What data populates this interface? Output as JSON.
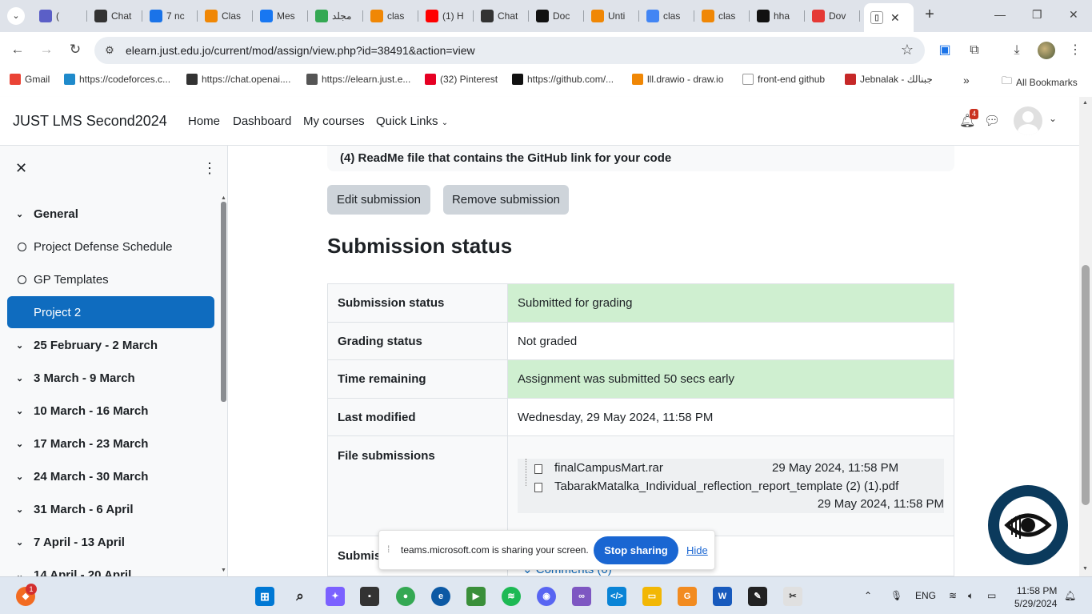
{
  "browser": {
    "tabs": [
      {
        "label": "(",
        "icon": "teams-icon",
        "color": "#5b5fc7"
      },
      {
        "label": "Chat",
        "icon": "chatgpt-icon",
        "color": "#333333"
      },
      {
        "label": "7 nc",
        "icon": "seven-icon",
        "color": "#1a73e8"
      },
      {
        "label": "Clas",
        "icon": "drawio-icon",
        "color": "#f08705"
      },
      {
        "label": "Mes",
        "icon": "facebook-icon",
        "color": "#1877f2"
      },
      {
        "label": "مجلد",
        "icon": "drive-icon",
        "color": "#34a853"
      },
      {
        "label": "clas",
        "icon": "drawio-icon",
        "color": "#f08705"
      },
      {
        "label": "(1) H",
        "icon": "youtube-icon",
        "color": "#ff0000"
      },
      {
        "label": "Chat",
        "icon": "chatgpt-icon",
        "color": "#333333"
      },
      {
        "label": "Doc",
        "icon": "notion-icon",
        "color": "#111111"
      },
      {
        "label": "Unti",
        "icon": "drawio-icon",
        "color": "#f08705"
      },
      {
        "label": "clas",
        "icon": "google-icon",
        "color": "#4285f4"
      },
      {
        "label": "clas",
        "icon": "drawio-icon",
        "color": "#f08705"
      },
      {
        "label": "hha",
        "icon": "github-icon",
        "color": "#111111"
      },
      {
        "label": "Dov",
        "icon": "heart-icon",
        "color": "#e53935"
      }
    ],
    "active_tab_icon": "moodle-book-icon",
    "url": "elearn.just.edu.jo/current/mod/assign/view.php?id=38491&action=view",
    "bookmarks": [
      {
        "label": "Gmail",
        "icon": "gmail-icon",
        "color": "#ea4335"
      },
      {
        "label": "https://codeforces.c...",
        "icon": "codeforces-icon",
        "color": "#1f8acb"
      },
      {
        "label": "https://chat.openai....",
        "icon": "chatgpt-icon",
        "color": "#333333"
      },
      {
        "label": "https://elearn.just.e...",
        "icon": "moodle-book-icon",
        "color": "#555555"
      },
      {
        "label": "(32) Pinterest",
        "icon": "pinterest-icon",
        "color": "#e60023"
      },
      {
        "label": "https://github.com/...",
        "icon": "github-icon",
        "color": "#111111"
      },
      {
        "label": "lll.drawio - draw.io",
        "icon": "drawio-icon",
        "color": "#f08705"
      },
      {
        "label": "front-end github",
        "icon": "globe-icon",
        "color": "#ffffff"
      },
      {
        "label": "Jebnalak - جبنالك",
        "icon": "jebnalak-icon",
        "color": "#c62828"
      }
    ],
    "all_bookmarks": "All Bookmarks"
  },
  "moodle": {
    "site_name": "JUST LMS Second2024",
    "nav": [
      "Home",
      "Dashboard",
      "My courses",
      "Quick Links"
    ],
    "notification_count": "4"
  },
  "course_index": {
    "items": [
      {
        "label": "General",
        "type": "section"
      },
      {
        "label": "Project Defense Schedule",
        "type": "activity"
      },
      {
        "label": "GP Templates",
        "type": "activity"
      },
      {
        "label": "Project 2",
        "type": "active"
      },
      {
        "label": "25 February - 2 March",
        "type": "section"
      },
      {
        "label": "3 March - 9 March",
        "type": "section"
      },
      {
        "label": "10 March - 16 March",
        "type": "section"
      },
      {
        "label": "17 March - 23 March",
        "type": "section"
      },
      {
        "label": "24 March - 30 March",
        "type": "section"
      },
      {
        "label": "31 March - 6 April",
        "type": "section"
      },
      {
        "label": "7 April - 13 April",
        "type": "section"
      },
      {
        "label": "14 April - 20 April",
        "type": "section"
      }
    ]
  },
  "main": {
    "readme_text": "(4) ReadMe file that contains the GitHub link for your code",
    "edit_button": "Edit submission",
    "remove_button": "Remove submission",
    "heading": "Submission status",
    "rows": [
      {
        "key": "Submission status",
        "value": "Submitted for grading",
        "highlight": true
      },
      {
        "key": "Grading status",
        "value": "Not graded",
        "highlight": false
      },
      {
        "key": "Time remaining",
        "value": "Assignment was submitted 50 secs early",
        "highlight": true
      },
      {
        "key": "Last modified",
        "value": "Wednesday, 29 May 2024, 11:58 PM",
        "highlight": false
      }
    ],
    "file_submissions_label": "File submissions",
    "files": [
      {
        "name": "finalCampusMart.rar",
        "date": "29 May 2024, 11:58 PM"
      },
      {
        "name": "TabarakMatalka_Individual_reflection_report_template (2) (1).pdf",
        "date": "29 May 2024, 11:58 PM"
      }
    ],
    "comments_row_label": "Submis",
    "comments_link": "Comments (0)"
  },
  "share_bar": {
    "message": "teams.microsoft.com is sharing your screen.",
    "stop_label": "Stop sharing",
    "hide_label": "Hide"
  },
  "taskbar": {
    "language": "ENG",
    "time": "11:58 PM",
    "date": "5/29/2024",
    "brave_badge": "1"
  }
}
